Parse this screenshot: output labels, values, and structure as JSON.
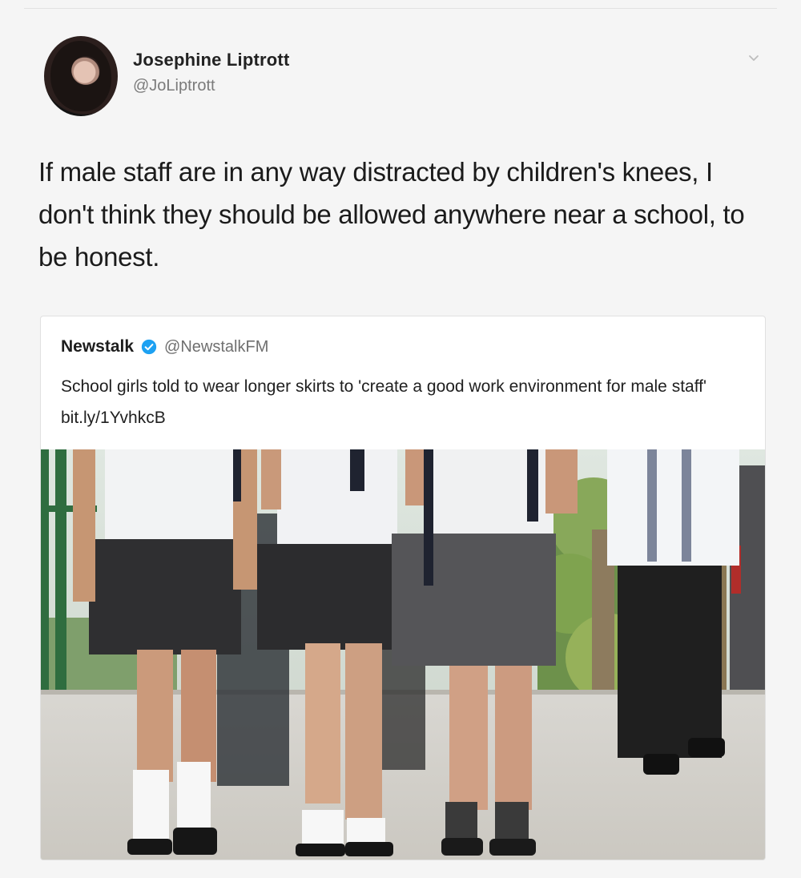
{
  "tweet": {
    "display_name": "Josephine Liptrott",
    "handle": "@JoLiptrott",
    "text": "If male staff are in any way distracted by children's knees, I don't think they should be allowed anywhere near a school, to be honest."
  },
  "quoted_tweet": {
    "display_name": "Newstalk",
    "handle": "@NewstalkFM",
    "text": "School girls told to wear longer skirts to 'create a good work environment for male staff' bit.ly/1YvhkcB"
  },
  "icons": {
    "menu": "chevron-down-icon",
    "verified": "verified-badge-icon"
  },
  "colors": {
    "verified_blue": "#1da1f2",
    "primary_text": "#1b1b1b",
    "secondary_text": "#7b7b7b"
  }
}
